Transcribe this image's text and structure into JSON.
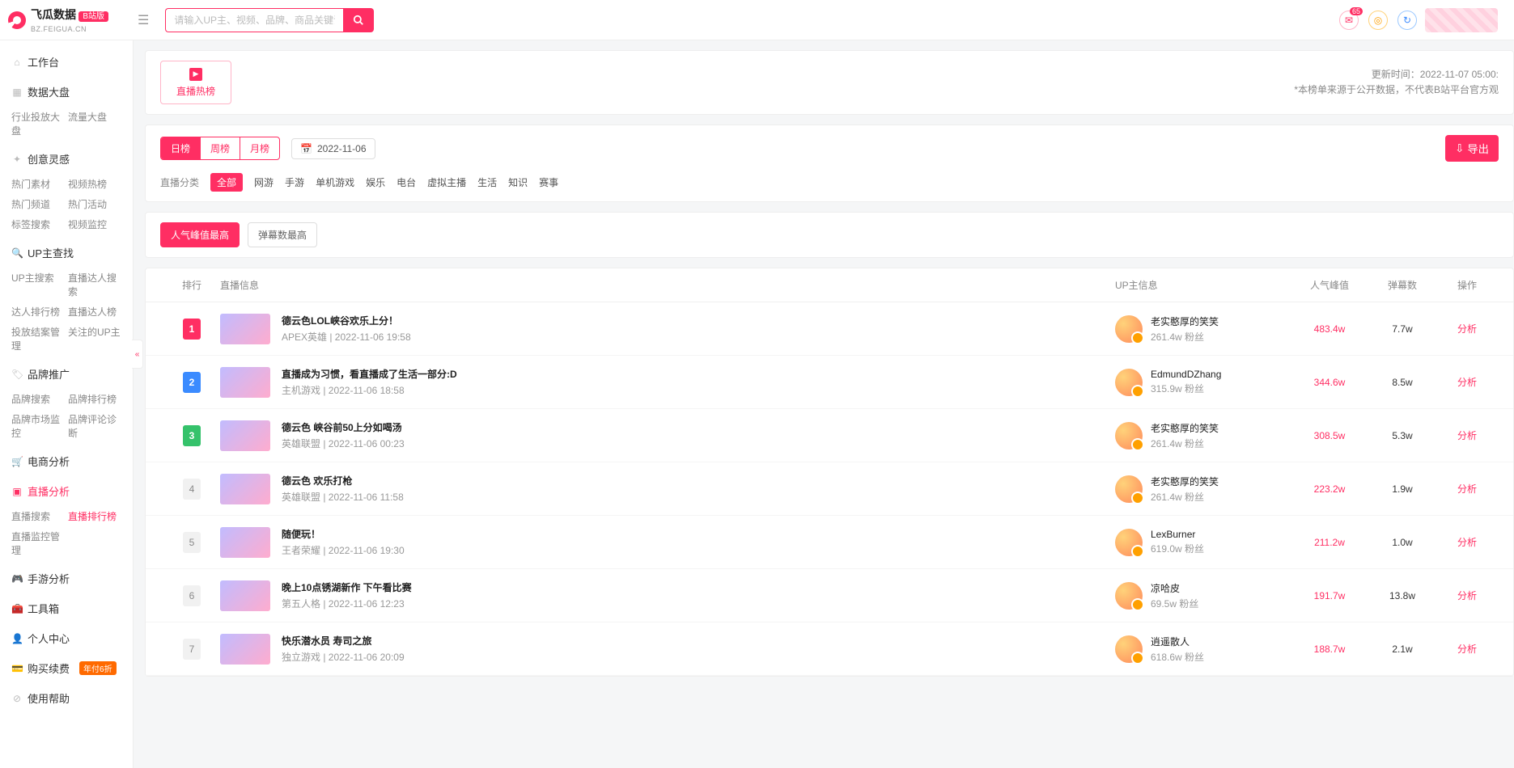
{
  "brand": {
    "name": "飞瓜数据",
    "sub": "BZ.FEIGUA.CN",
    "tag": "B站版"
  },
  "search": {
    "placeholder": "请输入UP主、视频、品牌、商品关键词搜索"
  },
  "mail_badge": "65",
  "sidebar": [
    {
      "icon": "home",
      "title": "工作台",
      "subs": []
    },
    {
      "icon": "grid",
      "title": "数据大盘",
      "subs": [
        "行业投放大盘",
        "流量大盘"
      ]
    },
    {
      "icon": "bulb",
      "title": "创意灵感",
      "subs": [
        "热门素材",
        "视频热榜",
        "热门频道",
        "热门活动",
        "标签搜索",
        "视频监控"
      ]
    },
    {
      "icon": "search",
      "title": "UP主查找",
      "subs": [
        "UP主搜索",
        "直播达人搜索",
        "达人排行榜",
        "直播达人榜",
        "投放结案管理",
        "关注的UP主"
      ]
    },
    {
      "icon": "tag",
      "title": "品牌推广",
      "subs": [
        "品牌搜索",
        "品牌排行榜",
        "品牌市场监控",
        "品牌评论诊断"
      ]
    },
    {
      "icon": "cart",
      "title": "电商分析",
      "subs": []
    },
    {
      "icon": "live",
      "title": "直播分析",
      "pink": true,
      "subs": [
        "直播搜索",
        "直播排行榜",
        "直播监控管理"
      ],
      "pinkSub": 1
    },
    {
      "icon": "game",
      "title": "手游分析",
      "subs": []
    },
    {
      "icon": "tool",
      "title": "工具箱",
      "subs": []
    },
    {
      "icon": "user",
      "title": "个人中心",
      "subs": []
    },
    {
      "icon": "pay",
      "title": "购买续费",
      "badge": "年付6折",
      "subs": []
    },
    {
      "icon": "help",
      "title": "使用帮助",
      "subs": []
    }
  ],
  "hot": {
    "label": "直播热榜",
    "update": "更新时间：2022-11-07 05:00:",
    "note": "*本榜单来源于公开数据，不代表B站平台官方观"
  },
  "period": {
    "tabs": [
      "日榜",
      "周榜",
      "月榜"
    ],
    "active": 0,
    "date": "2022-11-06"
  },
  "export_label": "导出",
  "cat": {
    "label": "直播分类",
    "items": [
      "全部",
      "网游",
      "手游",
      "单机游戏",
      "娱乐",
      "电台",
      "虚拟主播",
      "生活",
      "知识",
      "赛事"
    ],
    "active": 0
  },
  "metric": {
    "tabs": [
      "人气峰值最高",
      "弹幕数最高"
    ],
    "active": 0
  },
  "columns": {
    "rank": "排行",
    "live": "直播信息",
    "up": "UP主信息",
    "peak": "人气峰值",
    "dan": "弹幕数",
    "act": "操作"
  },
  "action_label": "分析",
  "fans_suffix": " 粉丝",
  "rows": [
    {
      "rank": 1,
      "title": "德云色LOL峡谷欢乐上分！",
      "cat": "APEX英雄",
      "time": "2022-11-06 19:58",
      "up": "老实憨厚的笑笑",
      "fans": "261.4w",
      "peak": "483.4w",
      "dan": "7.7w"
    },
    {
      "rank": 2,
      "title": "直播成为习惯，看直播成了生活一部分:D",
      "cat": "主机游戏",
      "time": "2022-11-06 18:58",
      "up": "EdmundDZhang",
      "fans": "315.9w",
      "peak": "344.6w",
      "dan": "8.5w"
    },
    {
      "rank": 3,
      "title": "德云色 峡谷前50上分如喝汤",
      "cat": "英雄联盟",
      "time": "2022-11-06 00:23",
      "up": "老实憨厚的笑笑",
      "fans": "261.4w",
      "peak": "308.5w",
      "dan": "5.3w"
    },
    {
      "rank": 4,
      "title": "德云色 欢乐打枪",
      "cat": "英雄联盟",
      "time": "2022-11-06 11:58",
      "up": "老实憨厚的笑笑",
      "fans": "261.4w",
      "peak": "223.2w",
      "dan": "1.9w"
    },
    {
      "rank": 5,
      "title": "随便玩！",
      "cat": "王者荣耀",
      "time": "2022-11-06 19:30",
      "up": "LexBurner",
      "fans": "619.0w",
      "peak": "211.2w",
      "dan": "1.0w"
    },
    {
      "rank": 6,
      "title": "晚上10点锈湖新作 下午看比赛",
      "cat": "第五人格",
      "time": "2022-11-06 12:23",
      "up": "凉哈皮",
      "fans": "69.5w",
      "peak": "191.7w",
      "dan": "13.8w"
    },
    {
      "rank": 7,
      "title": "快乐潜水员 寿司之旅",
      "cat": "独立游戏",
      "time": "2022-11-06 20:09",
      "up": "逍遥散人",
      "fans": "618.6w",
      "peak": "188.7w",
      "dan": "2.1w"
    }
  ]
}
